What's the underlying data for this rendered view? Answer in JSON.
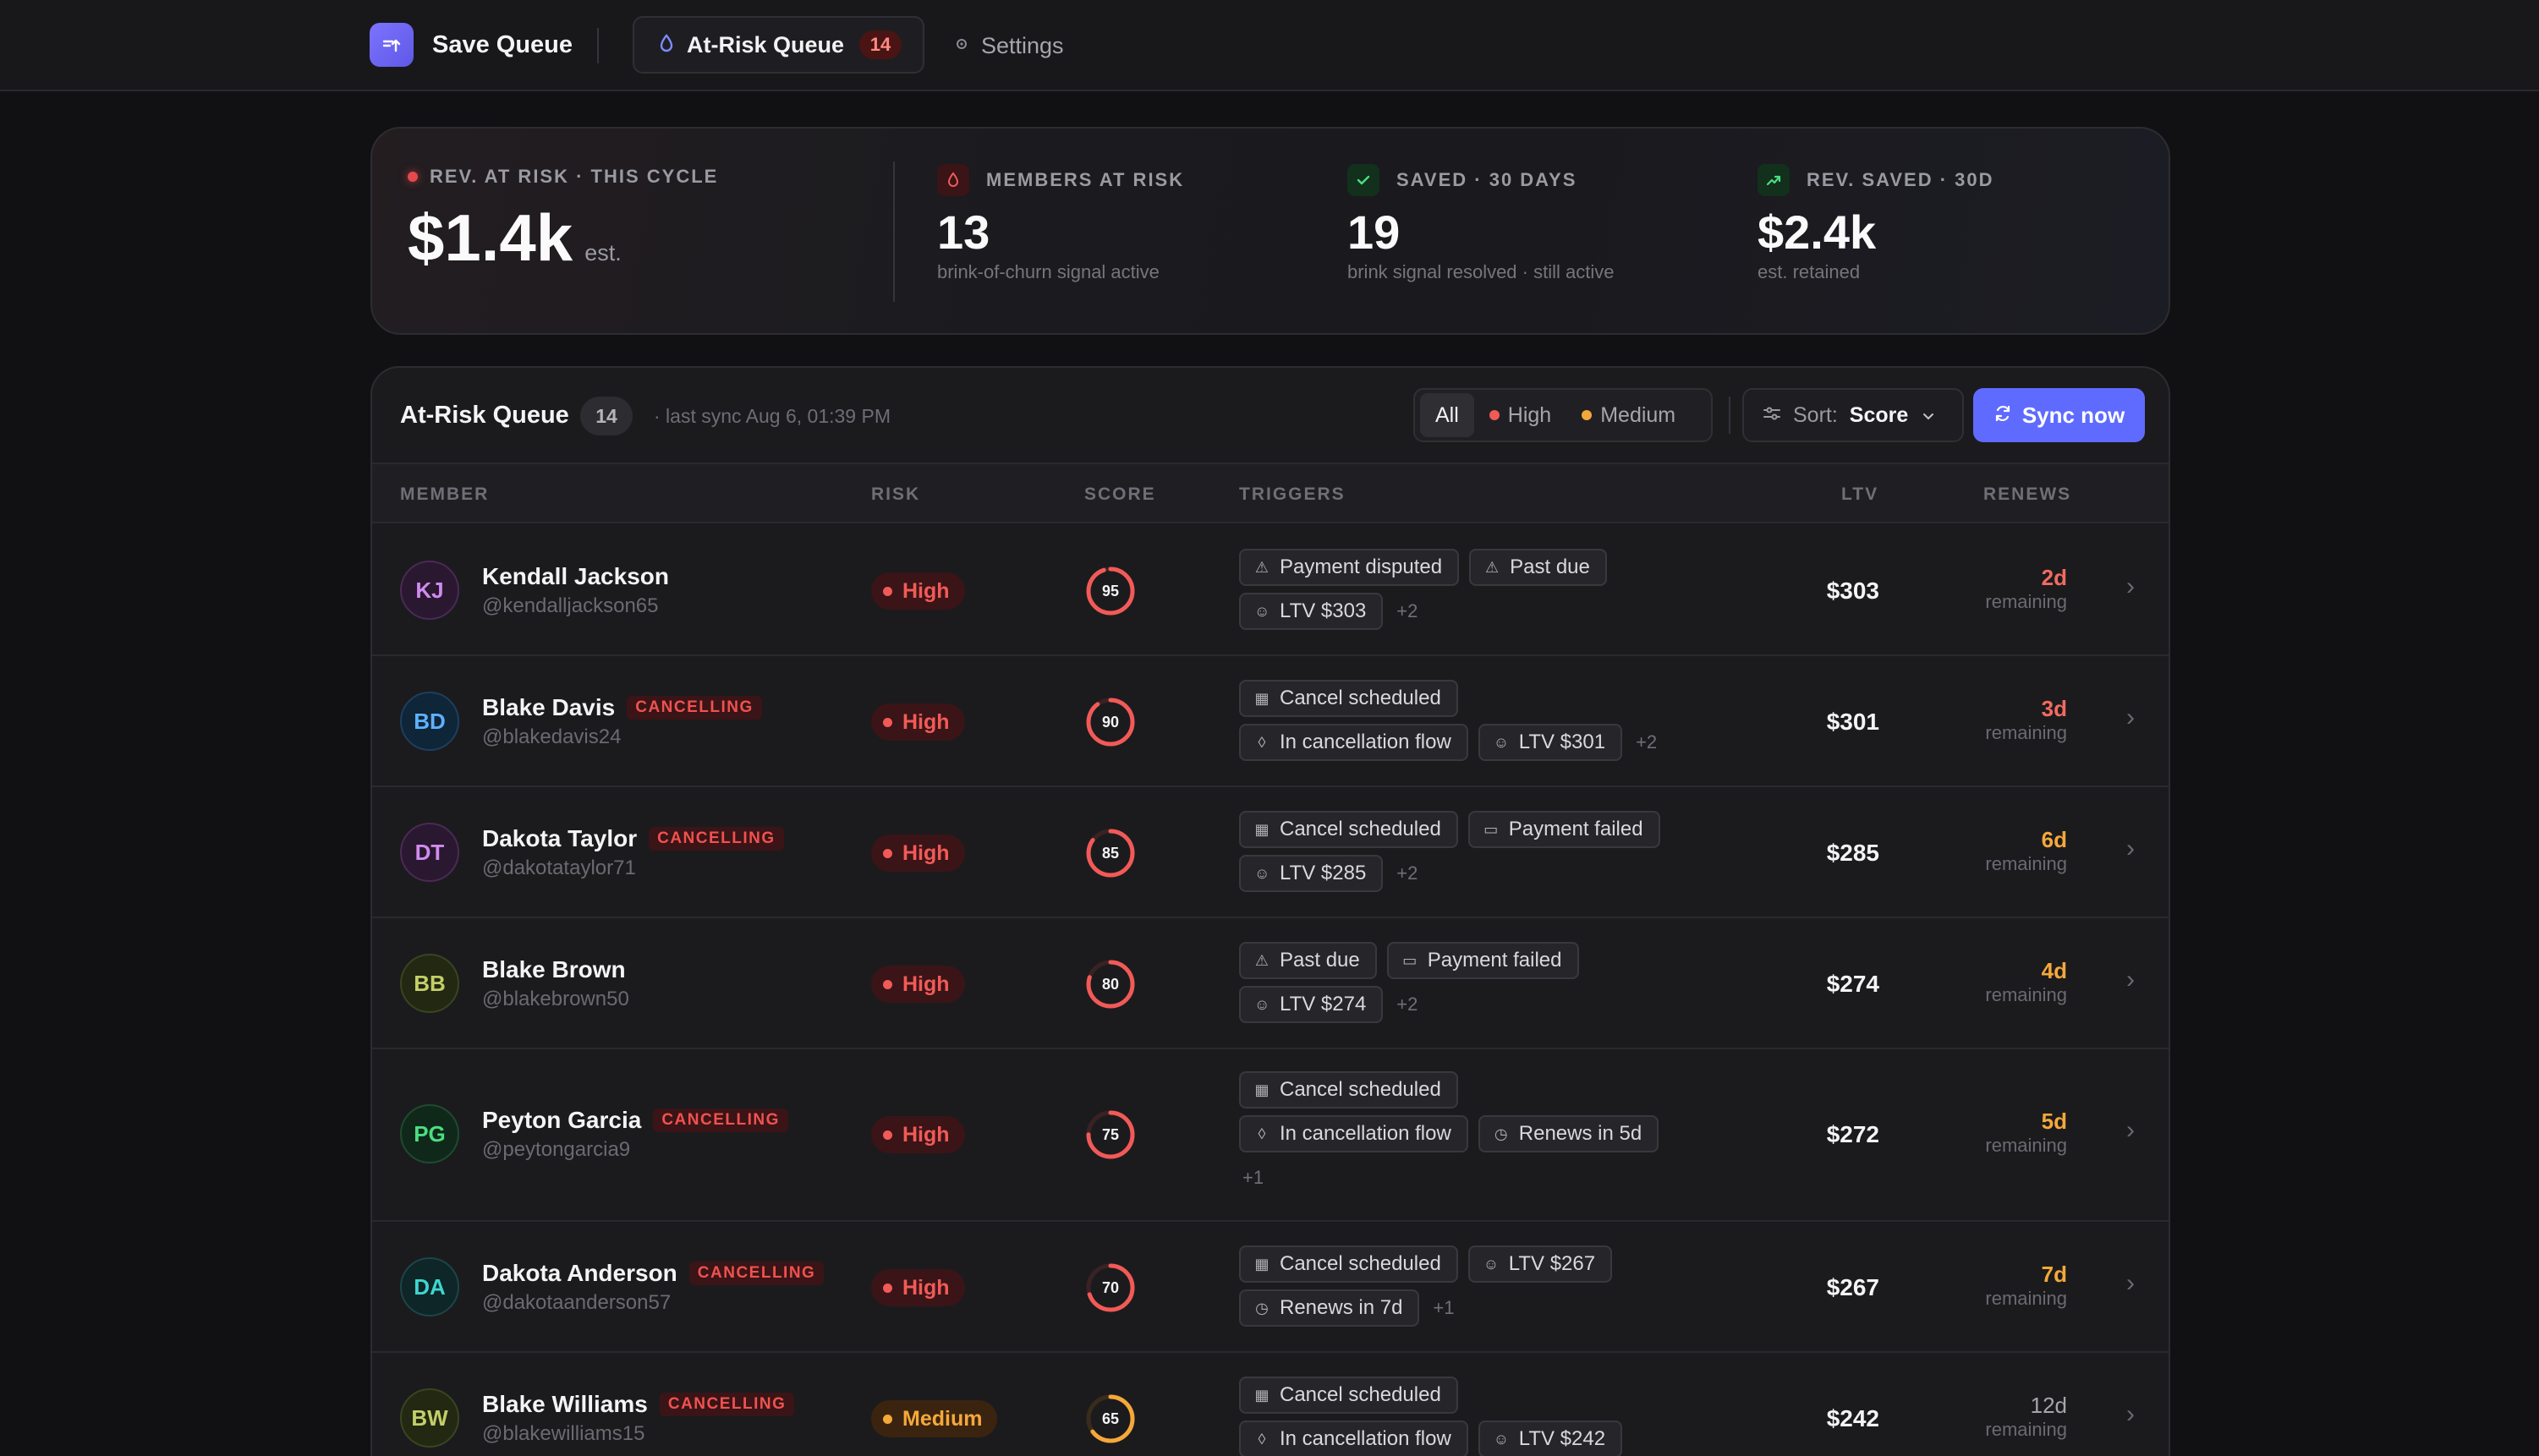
{
  "nav": {
    "app_name": "Save Queue",
    "tab_active": "At-Risk Queue",
    "tab_active_count": "14",
    "settings": "Settings"
  },
  "stats": {
    "rev_at_risk": {
      "label": "REV. AT RISK · THIS CYCLE",
      "value": "$1.4k",
      "suffix": "est."
    },
    "members_at_risk": {
      "label": "MEMBERS AT RISK",
      "value": "13",
      "sub": "brink-of-churn signal active"
    },
    "saved": {
      "label": "SAVED · 30 DAYS",
      "value": "19",
      "sub": "brink signal resolved · still active"
    },
    "rev_saved": {
      "label": "REV. SAVED · 30D",
      "value": "$2.4k",
      "sub": "est. retained"
    }
  },
  "queue": {
    "title": "At-Risk Queue",
    "count": "14",
    "last_sync": "· last sync Aug 6, 01:39 PM",
    "filters": {
      "all": "All",
      "high": "High",
      "medium": "Medium"
    },
    "sort_label": "Sort:",
    "sort_value": "Score",
    "sync_button": "Sync now",
    "columns": {
      "member": "MEMBER",
      "risk": "RISK",
      "score": "SCORE",
      "triggers": "TRIGGERS",
      "ltv": "LTV",
      "renews": "RENEWS"
    }
  },
  "rows": [
    {
      "initials": "KJ",
      "name": "Kendall Jackson",
      "handle": "@kendalljackson65",
      "cancelling": "",
      "risk": "High",
      "score": "95",
      "t1": {
        "a": "Payment disputed",
        "b": "Past due"
      },
      "t2": {
        "a": "LTV $303",
        "more": "+2"
      },
      "ltv": "$303",
      "renews": "2d",
      "remaining": "remaining"
    },
    {
      "initials": "BD",
      "name": "Blake Davis",
      "handle": "@blakedavis24",
      "cancelling": "CANCELLING",
      "risk": "High",
      "score": "90",
      "t1": {
        "a": "Cancel scheduled"
      },
      "t2": {
        "a": "In cancellation flow",
        "b": "LTV $301",
        "more": "+2"
      },
      "ltv": "$301",
      "renews": "3d",
      "remaining": "remaining"
    },
    {
      "initials": "DT",
      "name": "Dakota Taylor",
      "handle": "@dakotataylor71",
      "cancelling": "CANCELLING",
      "risk": "High",
      "score": "85",
      "t1": {
        "a": "Cancel scheduled",
        "b": "Payment failed"
      },
      "t2": {
        "a": "LTV $285",
        "more": "+2"
      },
      "ltv": "$285",
      "renews": "6d",
      "remaining": "remaining"
    },
    {
      "initials": "BB",
      "name": "Blake Brown",
      "handle": "@blakebrown50",
      "cancelling": "",
      "risk": "High",
      "score": "80",
      "t1": {
        "a": "Past due",
        "b": "Payment failed"
      },
      "t2": {
        "a": "LTV $274",
        "more": "+2"
      },
      "ltv": "$274",
      "renews": "4d",
      "remaining": "remaining"
    },
    {
      "initials": "PG",
      "name": "Peyton Garcia",
      "handle": "@peytongarcia9",
      "cancelling": "CANCELLING",
      "risk": "High",
      "score": "75",
      "t1": {
        "a": "Cancel scheduled"
      },
      "t2": {
        "a": "In cancellation flow",
        "b": "Renews in 5d"
      },
      "t3": {
        "more": "+1"
      },
      "ltv": "$272",
      "renews": "5d",
      "remaining": "remaining"
    },
    {
      "initials": "DA",
      "name": "Dakota Anderson",
      "handle": "@dakotaanderson57",
      "cancelling": "CANCELLING",
      "risk": "High",
      "score": "70",
      "t1": {
        "a": "Cancel scheduled",
        "b": "LTV $267"
      },
      "t2": {
        "a": "Renews in 7d",
        "more": "+1"
      },
      "ltv": "$267",
      "renews": "7d",
      "remaining": "remaining"
    },
    {
      "initials": "BW",
      "name": "Blake Williams",
      "handle": "@blakewilliams15",
      "cancelling": "CANCELLING",
      "risk": "Medium",
      "score": "65",
      "t1": {
        "a": "Cancel scheduled"
      },
      "t2": {
        "a": "In cancellation flow",
        "b": "LTV $242"
      },
      "ltv": "$242",
      "renews": "12d",
      "remaining": "remaining"
    }
  ],
  "colors": {
    "accent": "#5f6bff",
    "high": "#f25a57",
    "medium": "#f5a83a",
    "renew_urgent": "#f26b5f",
    "renew_soon": "#f5a83a",
    "renew_normal": "#a5a5ac"
  }
}
